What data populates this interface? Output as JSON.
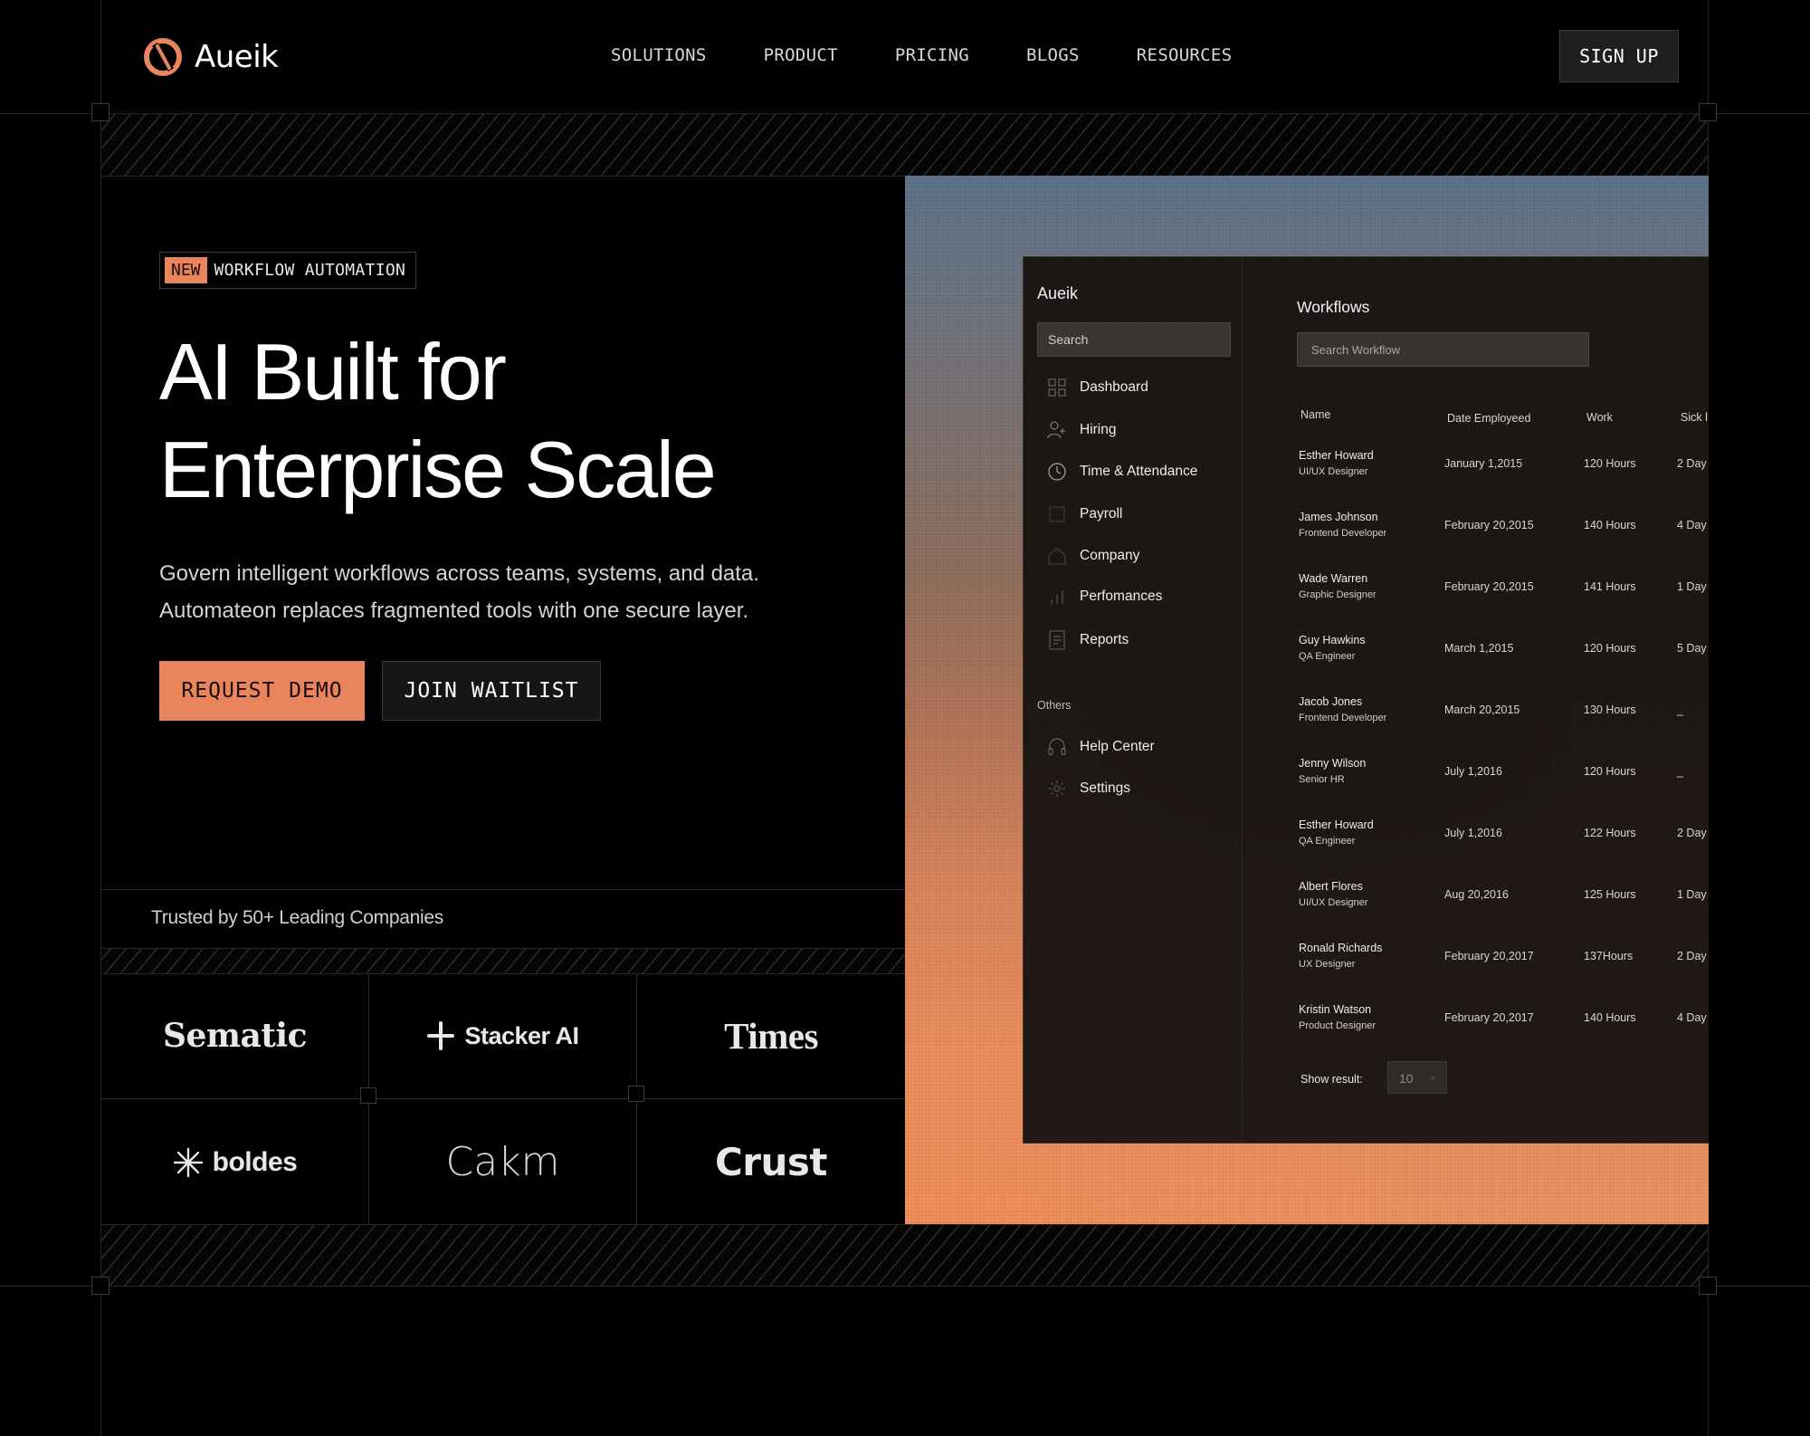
{
  "nav": {
    "brand": "Aueik",
    "links": [
      "SOLUTIONS",
      "PRODUCT",
      "PRICING",
      "BLOGS",
      "RESOURCES"
    ],
    "signup": "SIGN UP"
  },
  "hero": {
    "badge_new": "NEW",
    "badge_text": "WORKFLOW AUTOMATION",
    "title_line1": "AI Built for",
    "title_line2": "Enterprise Scale",
    "subtitle_line1": "Govern intelligent workflows across teams, systems, and data.",
    "subtitle_line2": "Automateon replaces fragmented tools with one secure layer.",
    "btn_demo": "REQUEST DEMO",
    "btn_waitlist": "JOIN WAITLIST"
  },
  "trusted": {
    "label": "Trusted by 50+ Leading Companies",
    "logos": [
      "Sematic",
      "Stacker AI",
      "Times",
      "boldes",
      "Cakm",
      "Crust"
    ]
  },
  "app": {
    "brand": "Aueik",
    "search_placeholder": "Search",
    "menu": [
      {
        "label": "Dashboard",
        "icon": "grid-icon"
      },
      {
        "label": "Hiring",
        "icon": "user-plus-icon"
      },
      {
        "label": "Time & Attendance",
        "icon": "clock-icon"
      },
      {
        "label": "Payroll",
        "icon": "square-icon"
      },
      {
        "label": "Company",
        "icon": "home-icon"
      },
      {
        "label": "Perfomances",
        "icon": "bar-chart-icon"
      },
      {
        "label": "Reports",
        "icon": "document-icon"
      }
    ],
    "others_label": "Others",
    "others": [
      {
        "label": "Help Center",
        "icon": "headset-icon"
      },
      {
        "label": "Settings",
        "icon": "gear-icon"
      }
    ],
    "workflows_title": "Workflows",
    "workflow_search_placeholder": "Search Workflow",
    "columns": [
      "Name",
      "Date Employeed",
      "Work",
      "Sick l"
    ],
    "rows": [
      {
        "name": "Esther Howard",
        "role": "UI/UX Designer",
        "date": "January 1,2015",
        "work": "120 Hours",
        "sick": "2 Day"
      },
      {
        "name": "James Johnson",
        "role": "Frontend Developer",
        "date": "February 20,2015",
        "work": "140 Hours",
        "sick": "4 Day"
      },
      {
        "name": "Wade Warren",
        "role": "Graphic Designer",
        "date": "February 20,2015",
        "work": "141 Hours",
        "sick": "1 Day"
      },
      {
        "name": "Guy Hawkins",
        "role": "QA Engineer",
        "date": "March 1,2015",
        "work": "120 Hours",
        "sick": "5 Day"
      },
      {
        "name": "Jacob Jones",
        "role": "Frontend Developer",
        "date": "March 20,2015",
        "work": "130 Hours",
        "sick": "_"
      },
      {
        "name": "Jenny Wilson",
        "role": "Senior HR",
        "date": "July 1,2016",
        "work": "120 Hours",
        "sick": "_"
      },
      {
        "name": "Esther Howard",
        "role": "QA Engineer",
        "date": "July 1,2016",
        "work": "122 Hours",
        "sick": "2 Day"
      },
      {
        "name": "Albert Flores",
        "role": "UI/UX Designer",
        "date": "Aug 20,2016",
        "work": "125 Hours",
        "sick": "1 Day"
      },
      {
        "name": "Ronald Richards",
        "role": "UX Designer",
        "date": "February 20,2017",
        "work": "137Hours",
        "sick": "2 Day"
      },
      {
        "name": "Kristin Watson",
        "role": "Product Designer",
        "date": "February 20,2017",
        "work": "140 Hours",
        "sick": "4 Day"
      }
    ],
    "show_result_label": "Show result:",
    "show_result_value": "10"
  },
  "colors": {
    "accent": "#e8855f",
    "background": "#000000",
    "panel": "#181412"
  }
}
